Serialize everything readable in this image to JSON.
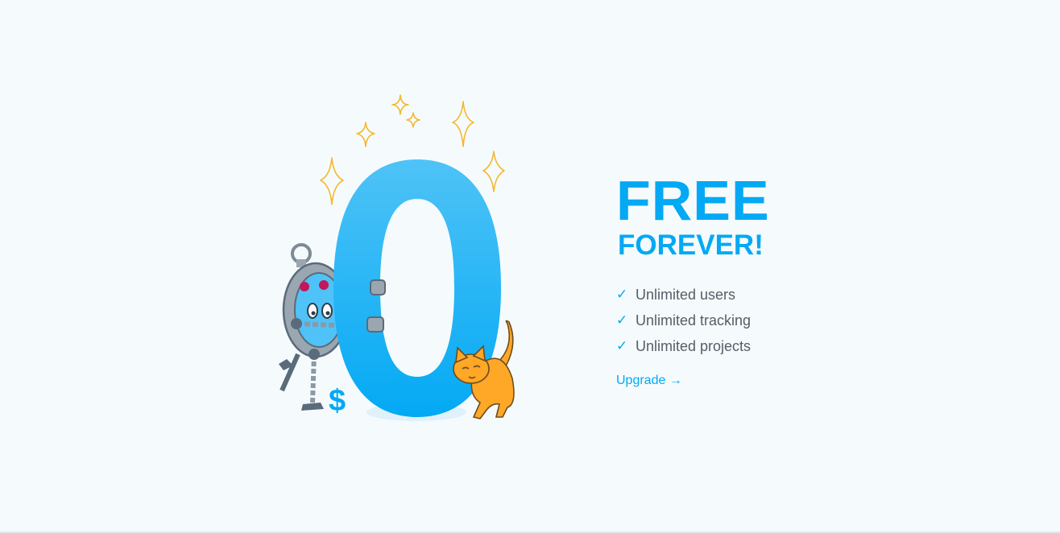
{
  "hero": {
    "big_digit": "0",
    "currency_symbol": "$"
  },
  "promo": {
    "title": "FREE",
    "subtitle": "FOREVER!",
    "check_glyph": "✓",
    "features": [
      "Unlimited users",
      "Unlimited tracking",
      "Unlimited projects"
    ],
    "upgrade_label": "Upgrade →"
  },
  "colors": {
    "accent": "#03a9f4",
    "accent_light": "#4fc3f7",
    "sparkle": "#f5b82e",
    "cat": "#ffa726",
    "robot_body": "#5a6b7b",
    "background": "#f5fbfd"
  }
}
